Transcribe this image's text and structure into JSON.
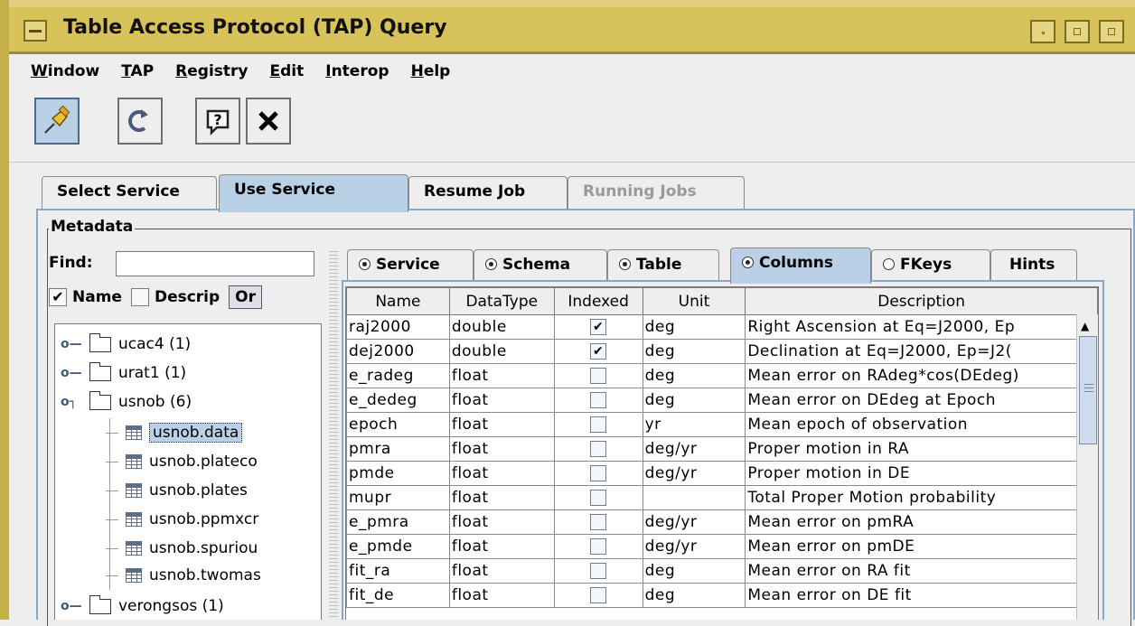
{
  "window": {
    "title": "Table Access Protocol (TAP) Query"
  },
  "menubar": {
    "items": [
      "Window",
      "TAP",
      "Registry",
      "Edit",
      "Interop",
      "Help"
    ]
  },
  "toolbar": {
    "buttons": [
      {
        "name": "pin",
        "icon": "pin-icon",
        "glyph": "📌",
        "pressed": true
      },
      {
        "name": "reload",
        "icon": "reload-icon",
        "glyph": "↻",
        "pressed": false
      },
      {
        "name": "help",
        "icon": "help-icon",
        "glyph": "?",
        "pressed": false
      },
      {
        "name": "close",
        "icon": "close-icon",
        "glyph": "✕",
        "pressed": false
      }
    ]
  },
  "tabs": {
    "items": [
      "Select Service",
      "Use Service",
      "Resume Job",
      "Running Jobs"
    ],
    "active": "Use Service",
    "disabled": [
      "Running Jobs"
    ]
  },
  "metadata": {
    "legend": "Metadata",
    "find_label": "Find:",
    "find_value": "",
    "name_label": "Name",
    "descrip_label": "Descrip",
    "name_checked": true,
    "descrip_checked": false,
    "or_button": "Or"
  },
  "tree": {
    "nodes": [
      {
        "label": "ucac4 (1)",
        "type": "schema",
        "expanded": false
      },
      {
        "label": "urat1 (1)",
        "type": "schema",
        "expanded": false
      },
      {
        "label": "usnob (6)",
        "type": "schema",
        "expanded": true
      },
      {
        "label": "usnob.data",
        "type": "table",
        "selected": true
      },
      {
        "label": "usnob.plateco",
        "type": "table"
      },
      {
        "label": "usnob.plates",
        "type": "table"
      },
      {
        "label": "usnob.ppmxcr",
        "type": "table"
      },
      {
        "label": "usnob.spuriou",
        "type": "table"
      },
      {
        "label": "usnob.twomas",
        "type": "table"
      },
      {
        "label": "verongsos (1)",
        "type": "schema",
        "expanded": false
      }
    ]
  },
  "inner_tabs": {
    "items": [
      {
        "label": "Service",
        "radio": true
      },
      {
        "label": "Schema",
        "radio": true
      },
      {
        "label": "Table",
        "radio": true
      },
      {
        "label": "Columns",
        "radio": true
      },
      {
        "label": "FKeys",
        "radio": false
      },
      {
        "label": "Hints",
        "radio": null
      }
    ],
    "active": "Columns"
  },
  "columns_table": {
    "headers": [
      "Name",
      "DataType",
      "Indexed",
      "Unit",
      "Description"
    ],
    "rows": [
      {
        "name": "raj2000",
        "type": "double",
        "indexed": true,
        "unit": "deg",
        "desc": "Right Ascension at Eq=J2000, Ep"
      },
      {
        "name": "dej2000",
        "type": "double",
        "indexed": true,
        "unit": "deg",
        "desc": "Declination at Eq=J2000, Ep=J2("
      },
      {
        "name": "e_radeg",
        "type": "float",
        "indexed": false,
        "unit": "deg",
        "desc": "Mean error on RAdeg*cos(DEdeg)"
      },
      {
        "name": "e_dedeg",
        "type": "float",
        "indexed": false,
        "unit": "deg",
        "desc": "Mean error on DEdeg at Epoch"
      },
      {
        "name": "epoch",
        "type": "float",
        "indexed": false,
        "unit": "yr",
        "desc": "Mean epoch of observation"
      },
      {
        "name": "pmra",
        "type": "float",
        "indexed": false,
        "unit": "deg/yr",
        "desc": "Proper motion in RA"
      },
      {
        "name": "pmde",
        "type": "float",
        "indexed": false,
        "unit": "deg/yr",
        "desc": "Proper motion in DE"
      },
      {
        "name": "mupr",
        "type": "float",
        "indexed": false,
        "unit": "",
        "desc": "Total Proper Motion probability"
      },
      {
        "name": "e_pmra",
        "type": "float",
        "indexed": false,
        "unit": "deg/yr",
        "desc": "Mean error on pmRA"
      },
      {
        "name": "e_pmde",
        "type": "float",
        "indexed": false,
        "unit": "deg/yr",
        "desc": "Mean error on pmDE"
      },
      {
        "name": "fit_ra",
        "type": "float",
        "indexed": false,
        "unit": "deg",
        "desc": "Mean error on RA fit"
      },
      {
        "name": "fit_de",
        "type": "float",
        "indexed": false,
        "unit": "deg",
        "desc": "Mean error on DE fit"
      }
    ]
  }
}
